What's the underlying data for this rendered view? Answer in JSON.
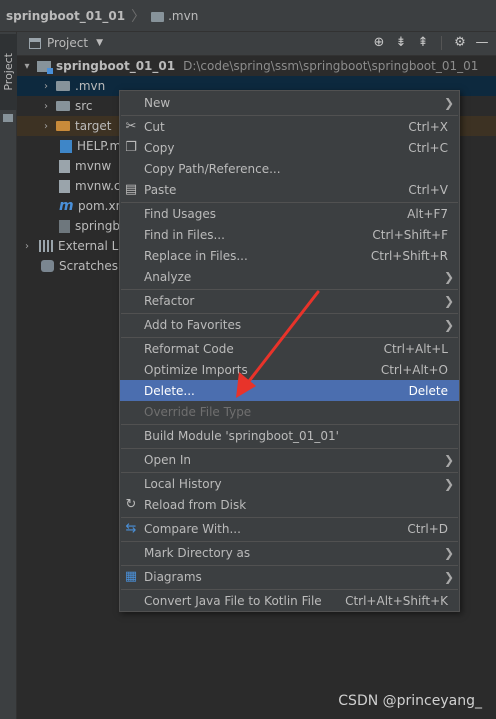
{
  "breadcrumb": {
    "project": "springboot_01_01",
    "folder": ".mvn"
  },
  "stripe": {
    "tab_label": "Project"
  },
  "panel": {
    "title": "Project",
    "icons": [
      "locate-icon",
      "expand-all-icon",
      "collapse-all-icon",
      "settings-icon",
      "hide-icon"
    ]
  },
  "tree": {
    "root_name": "springboot_01_01",
    "root_path": "D:\\code\\spring\\ssm\\springboot\\springboot_01_01",
    "items": [
      {
        "label": ".mvn"
      },
      {
        "label": "src"
      },
      {
        "label": "target"
      },
      {
        "label": "HELP.m"
      },
      {
        "label": "mvnw"
      },
      {
        "label": "mvnw.c"
      },
      {
        "label": "pom.xn"
      },
      {
        "label": "springb"
      },
      {
        "label": "External Li"
      },
      {
        "label": "Scratches"
      }
    ]
  },
  "menu": {
    "items": [
      {
        "label": "New",
        "shortcut": ""
      },
      {
        "label": "Cut",
        "shortcut": "Ctrl+X"
      },
      {
        "label": "Copy",
        "shortcut": "Ctrl+C"
      },
      {
        "label": "Copy Path/Reference...",
        "shortcut": ""
      },
      {
        "label": "Paste",
        "shortcut": "Ctrl+V"
      },
      {
        "label": "Find Usages",
        "shortcut": "Alt+F7"
      },
      {
        "label": "Find in Files...",
        "shortcut": "Ctrl+Shift+F"
      },
      {
        "label": "Replace in Files...",
        "shortcut": "Ctrl+Shift+R"
      },
      {
        "label": "Analyze",
        "shortcut": ""
      },
      {
        "label": "Refactor",
        "shortcut": ""
      },
      {
        "label": "Add to Favorites",
        "shortcut": ""
      },
      {
        "label": "Reformat Code",
        "shortcut": "Ctrl+Alt+L"
      },
      {
        "label": "Optimize Imports",
        "shortcut": "Ctrl+Alt+O"
      },
      {
        "label": "Delete...",
        "shortcut": "Delete"
      },
      {
        "label": "Override File Type",
        "shortcut": ""
      },
      {
        "label": "Build Module 'springboot_01_01'",
        "shortcut": ""
      },
      {
        "label": "Open In",
        "shortcut": ""
      },
      {
        "label": "Local History",
        "shortcut": ""
      },
      {
        "label": "Reload from Disk",
        "shortcut": ""
      },
      {
        "label": "Compare With...",
        "shortcut": "Ctrl+D"
      },
      {
        "label": "Mark Directory as",
        "shortcut": ""
      },
      {
        "label": "Diagrams",
        "shortcut": ""
      },
      {
        "label": "Convert Java File to Kotlin File",
        "shortcut": "Ctrl+Alt+Shift+K"
      }
    ]
  },
  "colors": {
    "menu_selected": "#4b6eaf",
    "annotation_arrow": "#e8332a"
  },
  "watermark": "CSDN @princeyang_"
}
